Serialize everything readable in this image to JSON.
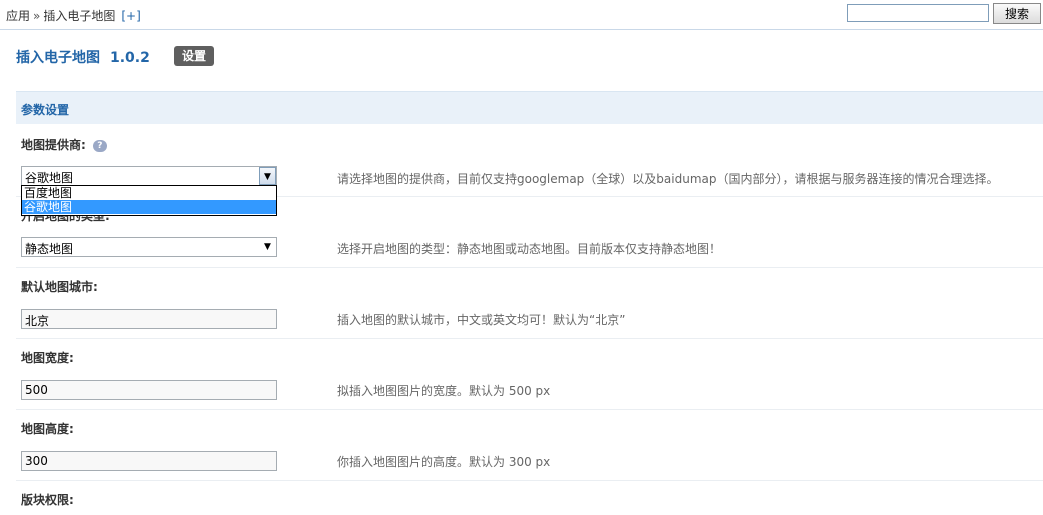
{
  "breadcrumb": {
    "root": "应用",
    "separator": "»",
    "current": "插入电子地图",
    "add_link": "[+]"
  },
  "search": {
    "value": "",
    "button_label": "搜索"
  },
  "plugin": {
    "name": "插入电子地图",
    "version": "1.0.2",
    "settings_badge": "设置"
  },
  "section": {
    "title": "参数设置"
  },
  "fields": {
    "provider": {
      "label": "地图提供商:",
      "selected": "谷歌地图",
      "options": [
        "百度地图",
        "谷歌地图"
      ],
      "highlighted_option": "谷歌地图",
      "description": "请选择地图的提供商，目前仅支持googlemap（全球）以及baidumap（国内部分），请根据与服务器连接的情况合理选择。"
    },
    "map_type": {
      "label": "开启地图的类型:",
      "selected": "静态地图",
      "description": "选择开启地图的类型：静态地图或动态地图。目前版本仅支持静态地图！"
    },
    "city": {
      "label": "默认地图城市:",
      "value": "北京",
      "description": "插入地图的默认城市，中文或英文均可！默认为“北京”"
    },
    "width": {
      "label": "地图宽度:",
      "value": "500",
      "description": "拟插入地图图片的宽度。默认为  500 px"
    },
    "height": {
      "label": "地图高度:",
      "value": "300",
      "description": "你插入地图图片的高度。默认为  300 px"
    },
    "permission": {
      "label": "版块权限:"
    }
  },
  "icons": {
    "help": "question-bubble-icon",
    "dropdown": "triangle-down-icon"
  },
  "colors": {
    "accent": "#2366a8",
    "section_bg": "#e9f1f9",
    "highlight": "#3399ff"
  }
}
